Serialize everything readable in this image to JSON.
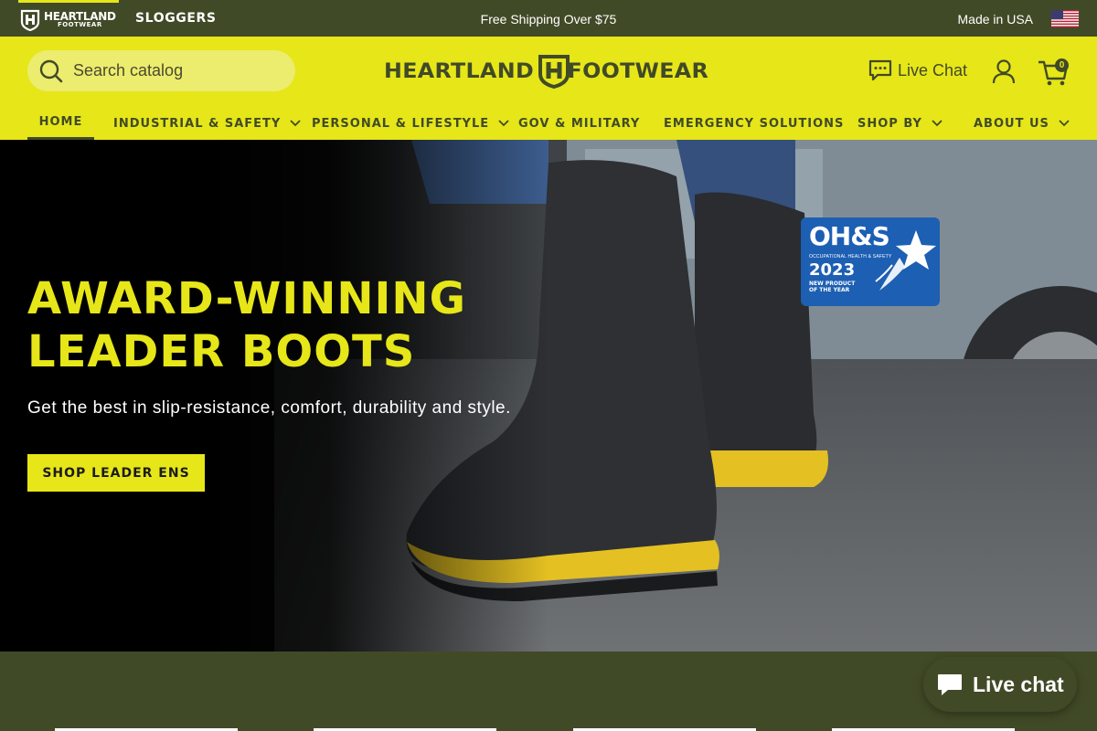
{
  "topbar": {
    "brands": [
      {
        "line1": "HEARTLAND",
        "line2": "FOOTWEAR"
      },
      {
        "label": "SLOGGERS"
      }
    ],
    "promo": "Free Shipping Over $75",
    "made_in": "Made in USA",
    "flag_icon": "us-flag-icon"
  },
  "header": {
    "search_placeholder": "Search catalog",
    "logo": {
      "left": "HEARTLAND",
      "right": "FOOTWEAR"
    },
    "live_chat": "Live Chat",
    "cart_count": "0",
    "colors": {
      "accent": "#e6e619",
      "dark": "#414a27"
    }
  },
  "nav": {
    "items": [
      {
        "label": "HOME",
        "active": true
      },
      {
        "label": "INDUSTRIAL & SAFETY",
        "dropdown": true
      },
      {
        "label": "PERSONAL & LIFESTYLE",
        "dropdown": true
      },
      {
        "label": "GOV & MILITARY",
        "dropdown": false
      },
      {
        "label": "EMERGENCY SOLUTIONS",
        "dropdown": false
      },
      {
        "label": "SHOP BY",
        "dropdown": true
      },
      {
        "label": "ABOUT US",
        "dropdown": true
      }
    ]
  },
  "hero": {
    "title_line1": "AWARD-WINNING",
    "title_line2": "LEADER BOOTS",
    "subtitle": "Get the best in slip-resistance, comfort, durability and style.",
    "cta": "SHOP LEADER ENS",
    "badge": {
      "title": "OH&S",
      "small": "OCCUPATIONAL HEALTH & SAFETY",
      "year": "2023",
      "line1": "NEW PRODUCT",
      "line2": "OF THE YEAR"
    }
  },
  "chat_widget": {
    "label": "Live chat"
  }
}
